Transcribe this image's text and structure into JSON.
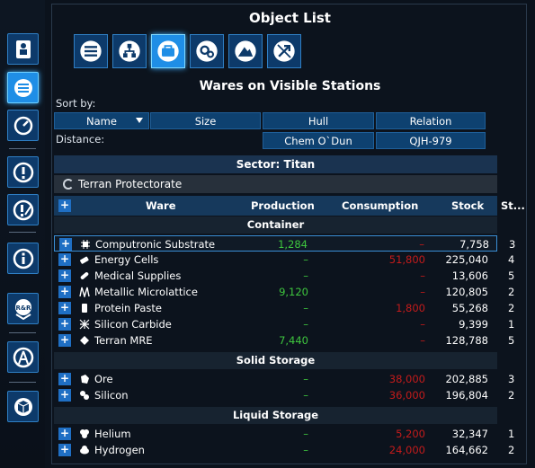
{
  "title": "Object List",
  "subtitle": "Wares on Visible Stations",
  "sort_label": "Sort by:",
  "distance_label": "Distance:",
  "sort_buttons": [
    "Name",
    "Size",
    "Hull",
    "Relation"
  ],
  "distance_buttons": [
    "Chem O`Dun",
    "QJH-979"
  ],
  "sector": "Sector: Titan",
  "faction": "Terran Protectorate",
  "columns": {
    "add": "+",
    "ware": "Ware",
    "production": "Production",
    "consumption": "Consumption",
    "stock": "Stock",
    "storage": "St..."
  },
  "groups": [
    {
      "name": "Container",
      "rows": [
        {
          "ware": "Computronic Substrate",
          "production": "1,284",
          "consumption": "–",
          "stock": "7,758",
          "st": "3",
          "icon": "chip-icon"
        },
        {
          "ware": "Energy Cells",
          "production": "–",
          "consumption": "51,800",
          "stock": "225,040",
          "st": "4",
          "icon": "battery-icon"
        },
        {
          "ware": "Medical Supplies",
          "production": "–",
          "consumption": "–",
          "stock": "13,606",
          "st": "5",
          "icon": "pill-icon"
        },
        {
          "ware": "Metallic Microlattice",
          "production": "9,120",
          "consumption": "–",
          "stock": "120,805",
          "st": "2",
          "icon": "lattice-icon"
        },
        {
          "ware": "Protein Paste",
          "production": "–",
          "consumption": "1,800",
          "stock": "55,268",
          "st": "2",
          "icon": "tube-icon"
        },
        {
          "ware": "Silicon Carbide",
          "production": "–",
          "consumption": "–",
          "stock": "9,399",
          "st": "1",
          "icon": "crystal-icon"
        },
        {
          "ware": "Terran MRE",
          "production": "7,440",
          "consumption": "–",
          "stock": "128,788",
          "st": "5",
          "icon": "ration-icon"
        }
      ]
    },
    {
      "name": "Solid Storage",
      "rows": [
        {
          "ware": "Ore",
          "production": "–",
          "consumption": "38,000",
          "stock": "202,885",
          "st": "3",
          "icon": "ore-icon"
        },
        {
          "ware": "Silicon",
          "production": "–",
          "consumption": "36,000",
          "stock": "196,804",
          "st": "2",
          "icon": "silicon-icon"
        }
      ]
    },
    {
      "name": "Liquid Storage",
      "rows": [
        {
          "ware": "Helium",
          "production": "–",
          "consumption": "5,200",
          "stock": "32,347",
          "st": "1",
          "icon": "helium-icon"
        },
        {
          "ware": "Hydrogen",
          "production": "–",
          "consumption": "24,000",
          "stock": "164,662",
          "st": "2",
          "icon": "hydrogen-icon"
        }
      ]
    }
  ],
  "colors": {
    "accent": "#1f8ee6",
    "positive": "#3ec63e",
    "negative": "#c31b1b",
    "button": "#0e4170"
  }
}
